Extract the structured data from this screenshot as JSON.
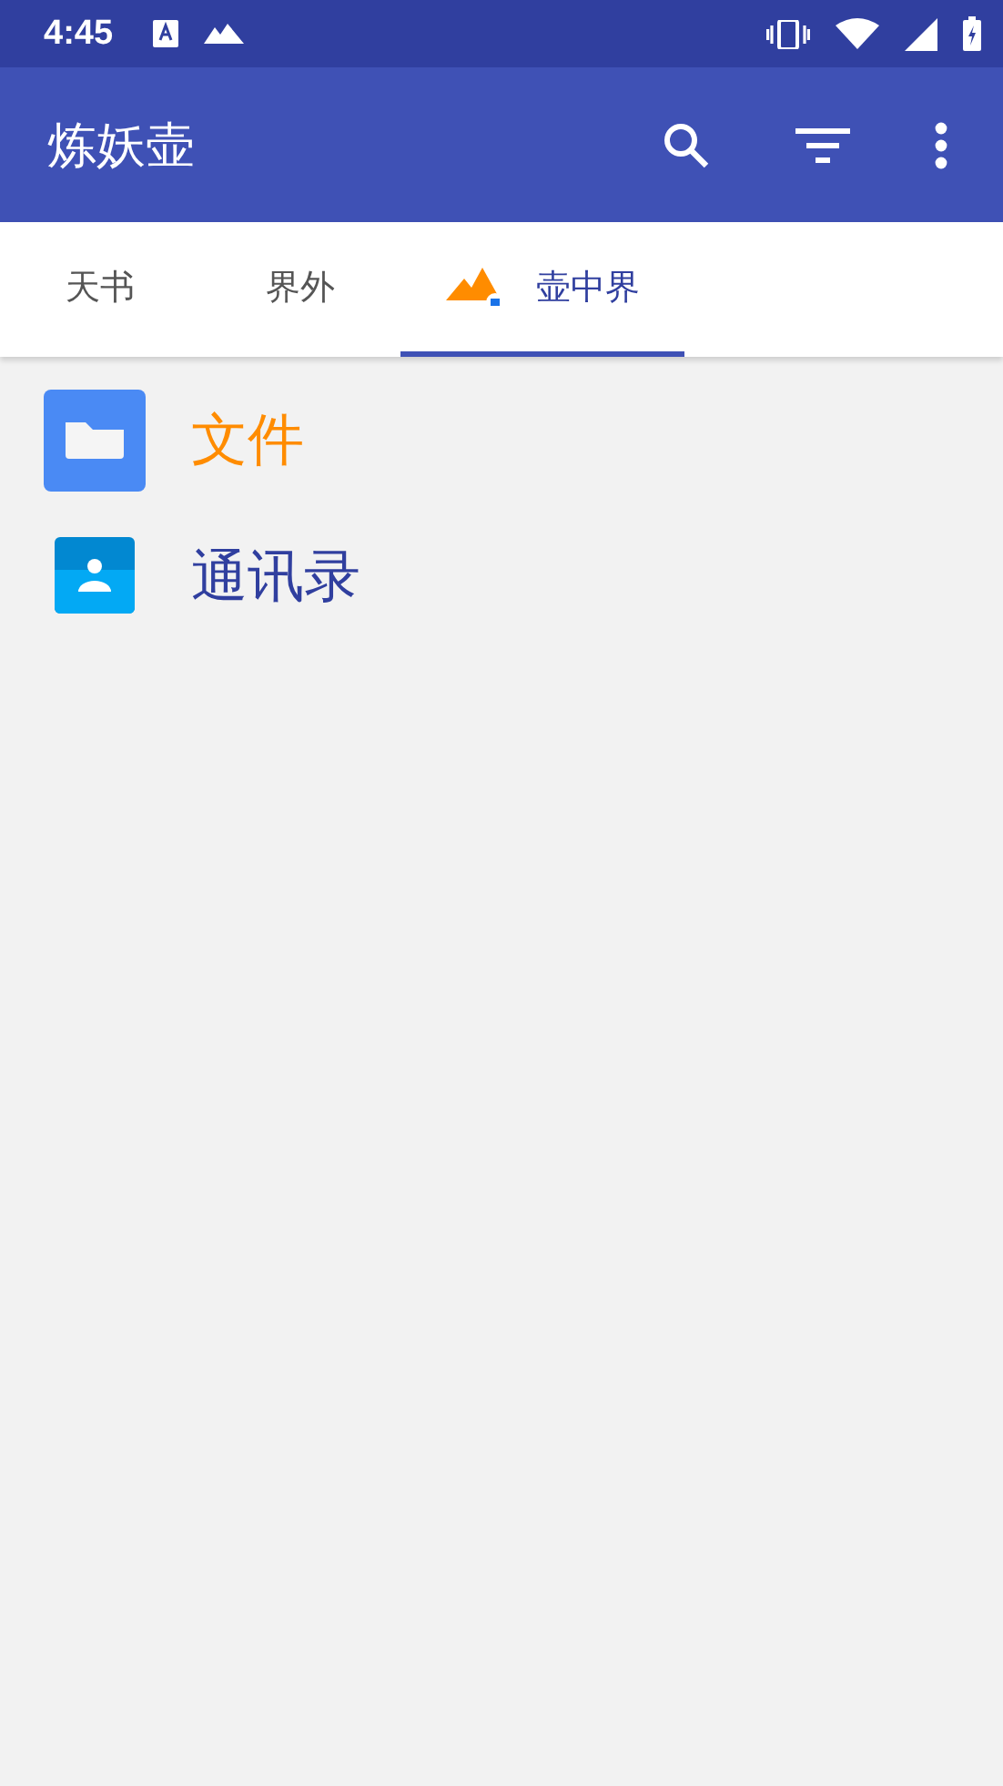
{
  "status_bar": {
    "time": "4:45"
  },
  "toolbar": {
    "title": "炼妖壶"
  },
  "tabs": [
    {
      "label": "天书",
      "selected": false,
      "kind": "plain"
    },
    {
      "label": "界外",
      "selected": false,
      "kind": "plain"
    },
    {
      "label": "壶中界",
      "selected": true,
      "kind": "with-icon"
    }
  ],
  "apps": [
    {
      "name": "文件",
      "kind": "files",
      "color": "#ff8c00"
    },
    {
      "name": "通讯录",
      "kind": "contacts",
      "color": "#303f9f"
    }
  ]
}
